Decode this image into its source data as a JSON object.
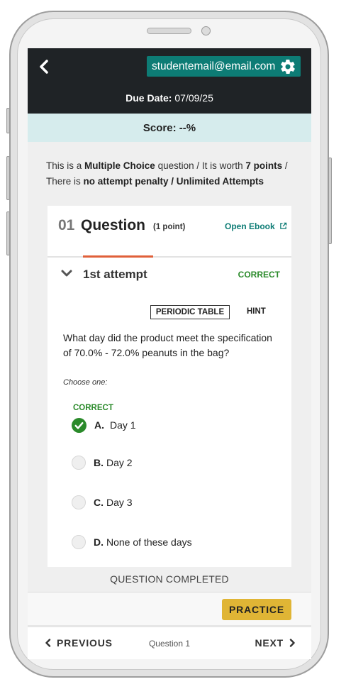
{
  "header": {
    "email": "studentemail@email.com",
    "due_date_label": "Due Date:",
    "due_date_value": "07/09/25"
  },
  "score": "Score: --%",
  "info": {
    "prefix": "This is a",
    "type": "Multiple Choice",
    "mid1": "question / It is worth",
    "points": "7 points",
    "mid2": "/",
    "line2_prefix": "There is",
    "penalty": "no attempt penalty / Unlimited Attempts"
  },
  "question": {
    "number": "01",
    "title": "Question",
    "points": "(1 point)",
    "open_ebook": "Open Ebook",
    "attempt_label": "1st attempt",
    "status": "CORRECT",
    "tools": {
      "periodic_table": "PERIODIC TABLE",
      "hint": "HINT"
    },
    "text": "What day did the product meet the specification of 70.0% - 72.0% peanuts in the bag?",
    "choose_one": "Choose one:",
    "choice_status": "CORRECT",
    "choices": [
      {
        "letter": "A.",
        "text": "Day 1",
        "selected": true
      },
      {
        "letter": "B.",
        "text": "Day 2",
        "selected": false
      },
      {
        "letter": "C.",
        "text": "Day 3",
        "selected": false
      },
      {
        "letter": "D.",
        "text": "None of these days",
        "selected": false
      }
    ]
  },
  "completed_text": "QUESTION COMPLETED",
  "practice_label": "PRACTICE",
  "footer": {
    "previous": "PREVIOUS",
    "indicator": "Question 1",
    "next": "NEXT"
  },
  "colors": {
    "header_bg": "#1f2326",
    "teal": "#0d7c75",
    "score_bg": "#d6eced",
    "correct_green": "#2a8a2a",
    "accent_orange": "#e0603a",
    "practice_yellow": "#e0b535"
  },
  "icons": {
    "back": "chevron-left-icon",
    "settings": "gear-icon",
    "external": "external-link-icon",
    "collapse": "chevron-down-icon",
    "check": "check-circle-icon"
  }
}
